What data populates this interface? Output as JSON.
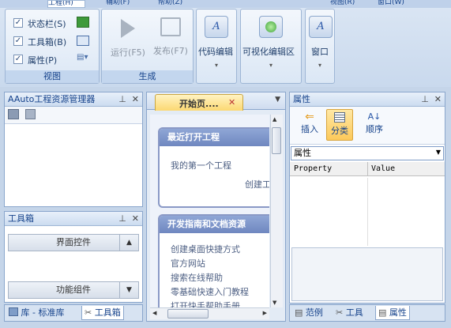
{
  "ribbon": {
    "tabs": [
      "工程(H)",
      "辅助(F)",
      "帮助(Z)",
      "视图(R)",
      "窗口(W)"
    ],
    "view_group": {
      "items": [
        {
          "label": "状态栏(S)",
          "checked": true
        },
        {
          "label": "工具箱(B)",
          "checked": true
        },
        {
          "label": "属性(P)",
          "checked": true
        }
      ],
      "caption": "视图"
    },
    "gen_group": {
      "run_label": "运行(F5)",
      "publish_label": "发布(F7)",
      "caption": "生成"
    },
    "code_edit_label": "代码编辑",
    "visual_edit_label": "可视化编辑区",
    "window_label": "窗口"
  },
  "res_panel": {
    "title": "AAuto工程资源管理器"
  },
  "toolbox_panel": {
    "title": "工具箱",
    "group1": "界面控件",
    "group2": "功能组件"
  },
  "left_tabs": {
    "lib": "库 - 标准库",
    "toolbox": "工具箱"
  },
  "center": {
    "tab_label": "开始页....",
    "recent_header": "最近打开工程",
    "recent_item": "我的第一个工程",
    "new_project": "创建工",
    "guide_header": "开发指南和文档资源",
    "links": [
      "创建桌面快捷方式",
      "官方网站",
      "搜索在线帮助",
      "零基础快速入门教程",
      "打开快手帮助手册"
    ]
  },
  "props_panel": {
    "title": "属性",
    "insert": "插入",
    "category": "分类",
    "sort": "顺序",
    "dropdown": "属性",
    "col_property": "Property",
    "col_value": "Value"
  },
  "right_tabs": {
    "examples": "范例",
    "tools": "工具",
    "props": "属性"
  },
  "colors": {
    "accent": "#15428b",
    "section_header": "#7f96cc",
    "active_tab": "#fcd872"
  }
}
